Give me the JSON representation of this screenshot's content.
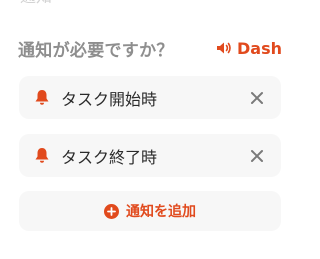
{
  "header": {
    "faded_text": "通知",
    "question": "通知が必要ですか？",
    "sound_label": "Dash"
  },
  "notifications": [
    {
      "label": "タスク開始時",
      "icon": "bell-icon"
    },
    {
      "label": "タスク終了時",
      "icon": "bell-icon"
    }
  ],
  "add_button": {
    "label": "通知を追加",
    "icon": "plus-circle-icon"
  },
  "colors": {
    "accent": "#e14a1d",
    "card_bg": "#f7f7f7",
    "question_text": "#8e8e8e",
    "close_icon": "#7a7a7a"
  }
}
